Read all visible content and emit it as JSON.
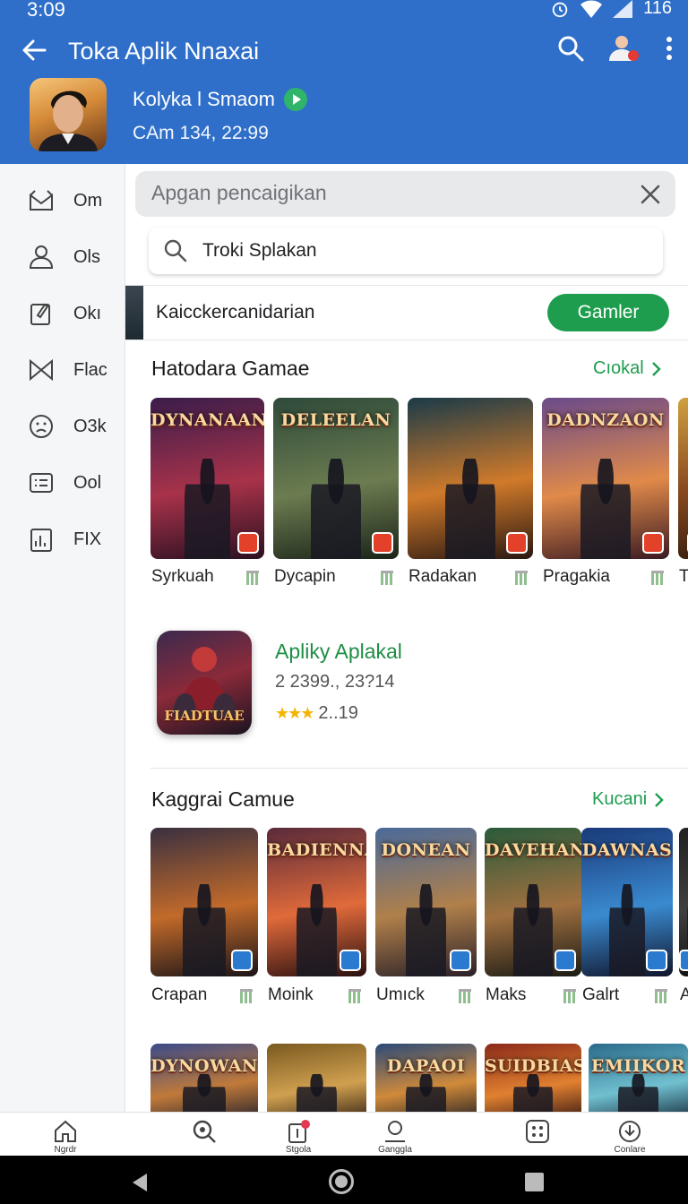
{
  "status_bar": {
    "time": "3:09",
    "battery": "116"
  },
  "app_bar": {
    "title": "Toka Aplik Nnaxai"
  },
  "profile": {
    "name": "Kolyka l Smaom",
    "subtitle": "CAm 134, 22:99"
  },
  "sidebar": {
    "items": [
      {
        "label": "Om",
        "icon": "mail-icon"
      },
      {
        "label": "Ols",
        "icon": "person-icon"
      },
      {
        "label": "Okı",
        "icon": "edit-icon"
      },
      {
        "label": "Flac",
        "icon": "bowtie-icon"
      },
      {
        "label": "O3k",
        "icon": "face-icon"
      },
      {
        "label": "Ool",
        "icon": "list-icon"
      },
      {
        "label": "FIX",
        "icon": "chart-icon"
      }
    ]
  },
  "search": {
    "bar_placeholder": "Apgan pencaigikan",
    "input_value": "Troki Splakan"
  },
  "promo": {
    "text": "Kaicckercanidarian",
    "button": "Gamler"
  },
  "section1": {
    "title": "Hatodara Gamae",
    "more": "Cıokal",
    "cards": [
      {
        "label": "Syrkuah",
        "art": "DYNANAAN",
        "colors": [
          "#3a1d4a",
          "#a8324a",
          "#2a1020"
        ]
      },
      {
        "label": "Dycapin",
        "art": "DELEELAN",
        "colors": [
          "#2e4a3a",
          "#6c7c50",
          "#1a2418"
        ]
      },
      {
        "label": "Radakan",
        "art": "",
        "colors": [
          "#1a3a48",
          "#d07a2a",
          "#2a1812"
        ]
      },
      {
        "label": "Pragakia",
        "art": "DADNZAON",
        "colors": [
          "#6a4a8a",
          "#e08a4a",
          "#3a1a22"
        ]
      },
      {
        "label": "T",
        "art": "",
        "colors": [
          "#d0a040",
          "#8a4a20",
          "#3a2010"
        ]
      }
    ]
  },
  "featured": {
    "title": "Apliky Aplakal",
    "subtitle": "2 2399., 23?14",
    "stars": "★★★",
    "rating": "2..19",
    "icon_text": "FIADTUAE"
  },
  "section2": {
    "title": "Kaggrai Camue",
    "more": "Kucani",
    "cards": [
      {
        "label": "Crapan",
        "art": "",
        "colors": [
          "#3a3040",
          "#c26a2a",
          "#1a1418"
        ]
      },
      {
        "label": "Moink",
        "art": "BADIENNAKS",
        "colors": [
          "#5a2a3a",
          "#e06a3a",
          "#2a1010"
        ]
      },
      {
        "label": "Umıck",
        "art": "DONEAN",
        "colors": [
          "#4a6a9a",
          "#b0804a",
          "#2a2028"
        ]
      },
      {
        "label": "Maks",
        "art": "DAVEHAN",
        "colors": [
          "#2a5a3a",
          "#a07040",
          "#1a1a14"
        ]
      },
      {
        "label": "Galrt",
        "art": "DAWNAS",
        "colors": [
          "#1a3a7a",
          "#3a8ad0",
          "#10142a"
        ]
      },
      {
        "label": "A",
        "art": "",
        "colors": [
          "#202020",
          "#404040",
          "#101010"
        ]
      }
    ]
  },
  "section3": {
    "cards": [
      {
        "art": "DYNOWAN",
        "colors": [
          "#3a4a8a",
          "#c07a3a",
          "#1a1a2a"
        ]
      },
      {
        "art": "",
        "colors": [
          "#7a5a20",
          "#d0a050",
          "#2a1a10"
        ]
      },
      {
        "art": "DAPAOI",
        "colors": [
          "#2a4a7a",
          "#d08a3a",
          "#1a1a22"
        ]
      },
      {
        "art": "SUIDBIAS",
        "colors": [
          "#8a2a1a",
          "#e08030",
          "#2a1010"
        ]
      },
      {
        "art": "EMIIKOR",
        "colors": [
          "#2a6a8a",
          "#70c0d0",
          "#102030"
        ]
      }
    ]
  },
  "bottom_nav": {
    "items": [
      {
        "label": "Ngrdr",
        "icon": "home-icon"
      },
      {
        "label": "",
        "icon": "search-icon"
      },
      {
        "label": "Stgola",
        "icon": "notification-icon"
      },
      {
        "label": "Ganggla",
        "icon": "profile-icon"
      },
      {
        "label": "",
        "icon": "apps-icon"
      },
      {
        "label": "Conlare",
        "icon": "download-icon"
      }
    ]
  }
}
